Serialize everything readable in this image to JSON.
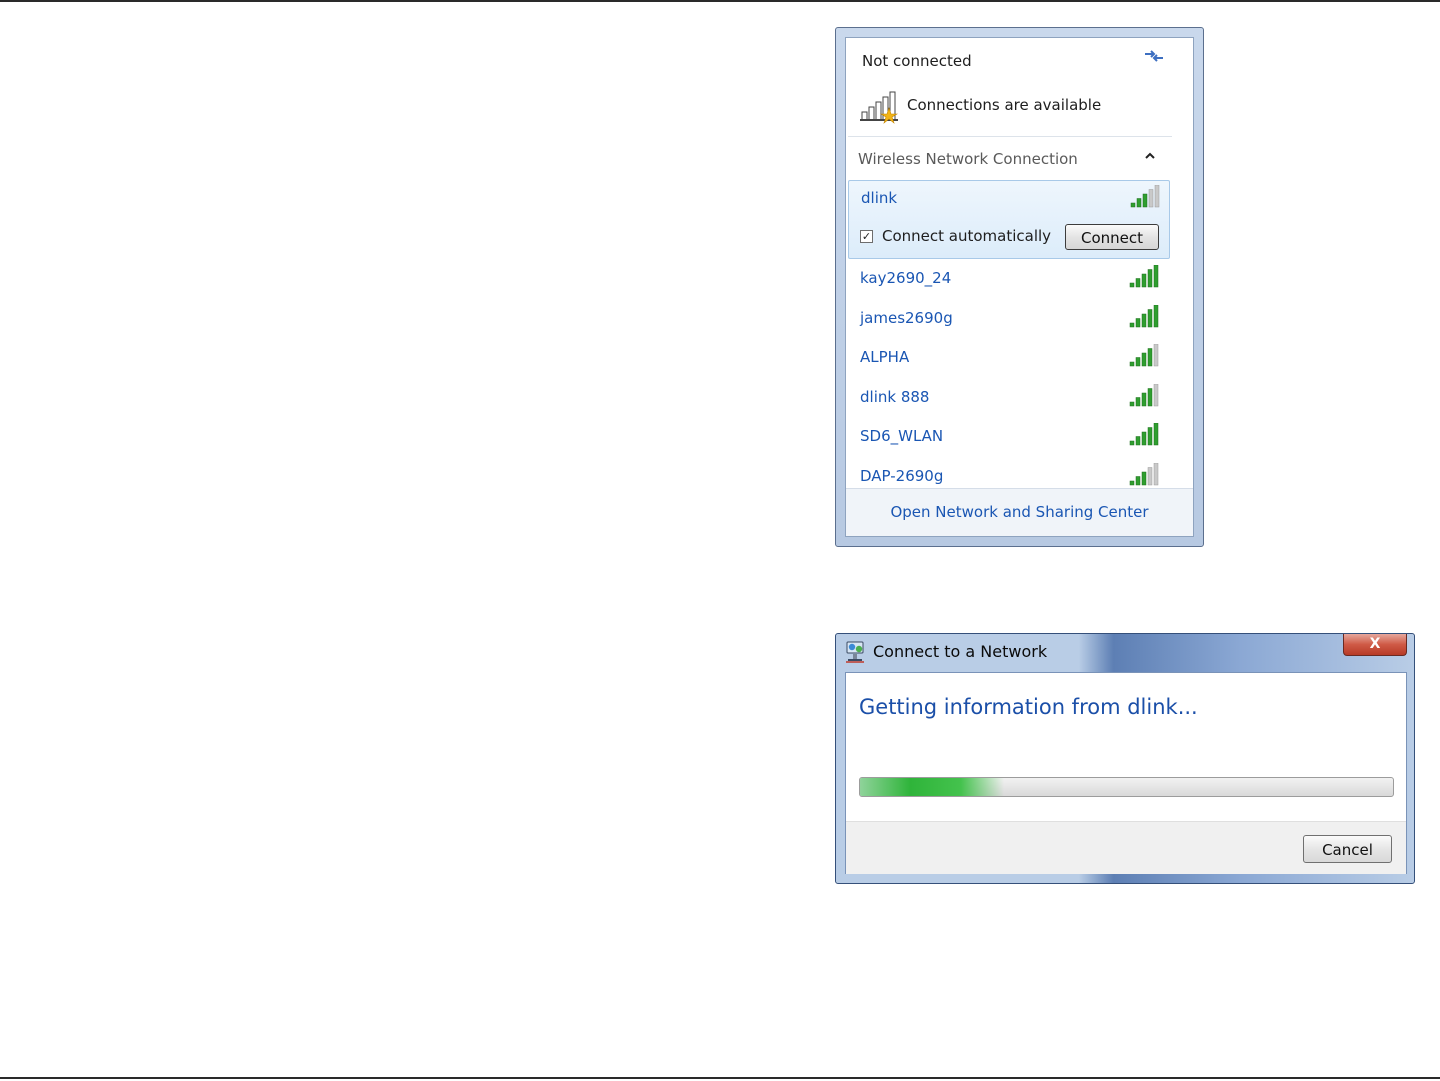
{
  "flyout": {
    "status_title": "Not connected",
    "availability_text": "Connections are available",
    "section_title": "Wireless Network Connection",
    "selected_network": {
      "name": "dlink",
      "connect_auto_label": "Connect automatically",
      "connect_auto_checked": true,
      "checkbox_mark": "✓",
      "connect_button_label": "Connect",
      "signal_bars": 3
    },
    "networks": [
      {
        "name": "kay2690_24",
        "signal_bars": 5
      },
      {
        "name": "james2690g",
        "signal_bars": 5
      },
      {
        "name": "ALPHA",
        "signal_bars": 4
      },
      {
        "name": "dlink 888",
        "signal_bars": 4
      },
      {
        "name": "SD6_WLAN",
        "signal_bars": 5
      },
      {
        "name": "DAP-2690g",
        "signal_bars": 3
      }
    ],
    "footer_link": "Open Network and Sharing Center",
    "scroll_up_glyph": "▲",
    "scroll_down_glyph": "▼",
    "icons": {
      "refresh": "refresh-arrows-icon",
      "availability": "signal-bars-star-icon",
      "collapse": "chevron-up-icon"
    },
    "colors": {
      "link": "#1a56b3",
      "signal": "#2f9e2f"
    }
  },
  "dialog": {
    "title": "Connect to a Network",
    "close_glyph": "X",
    "message": "Getting information from dlink...",
    "progress_fraction": 0.27,
    "cancel_label": "Cancel",
    "colors": {
      "message": "#1b4fa8",
      "progress": "#2fb43a"
    }
  }
}
